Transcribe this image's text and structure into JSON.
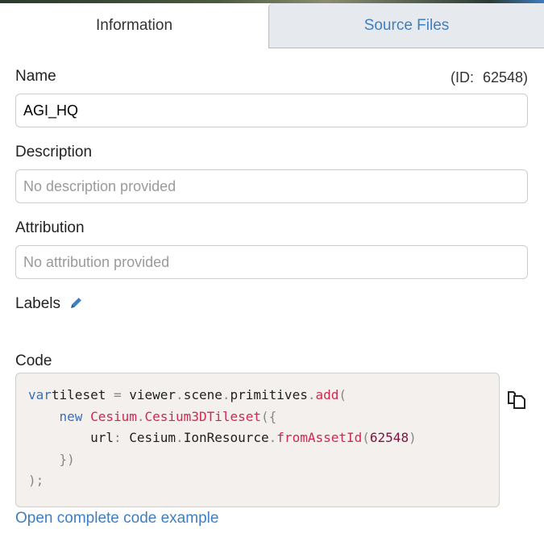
{
  "tabs": [
    {
      "label": "Information",
      "active": true
    },
    {
      "label": "Source Files",
      "active": false
    }
  ],
  "name": {
    "label": "Name",
    "id_text": "(ID: 62548)",
    "value": "AGI_HQ"
  },
  "description": {
    "label": "Description",
    "placeholder": "No description provided"
  },
  "attribution": {
    "label": "Attribution",
    "placeholder": "No attribution provided"
  },
  "labels": {
    "label": "Labels",
    "icon": "pencil-icon"
  },
  "code": {
    "label": "Code",
    "copy_icon": "copy-icon",
    "lines": [
      [
        [
          "kw",
          "var"
        ],
        [
          "",
          "tileset "
        ],
        [
          "pu",
          "="
        ],
        [
          "",
          " viewer"
        ],
        [
          "pu",
          "."
        ],
        [
          "",
          "scene"
        ],
        [
          "pu",
          "."
        ],
        [
          "",
          "primitives"
        ],
        [
          "pu",
          "."
        ],
        [
          "fn",
          "add"
        ],
        [
          "pu",
          "("
        ]
      ],
      [
        [
          "",
          "    "
        ],
        [
          "kw",
          "new"
        ],
        [
          "",
          " "
        ],
        [
          "fn",
          "Cesium"
        ],
        [
          "pu",
          "."
        ],
        [
          "fn",
          "Cesium3DTileset"
        ],
        [
          "pu",
          "({"
        ]
      ],
      [
        [
          "",
          "        url"
        ],
        [
          "pu",
          ":"
        ],
        [
          "",
          " Cesium"
        ],
        [
          "pu",
          "."
        ],
        [
          "",
          "IonResource"
        ],
        [
          "pu",
          "."
        ],
        [
          "fn",
          "fromAssetId"
        ],
        [
          "pu",
          "("
        ],
        [
          "nu",
          "62548"
        ],
        [
          "pu",
          ")"
        ]
      ],
      [
        [
          "pu",
          "    })"
        ]
      ],
      [
        [
          "pu",
          ");"
        ]
      ]
    ]
  },
  "link": "Open complete code example"
}
